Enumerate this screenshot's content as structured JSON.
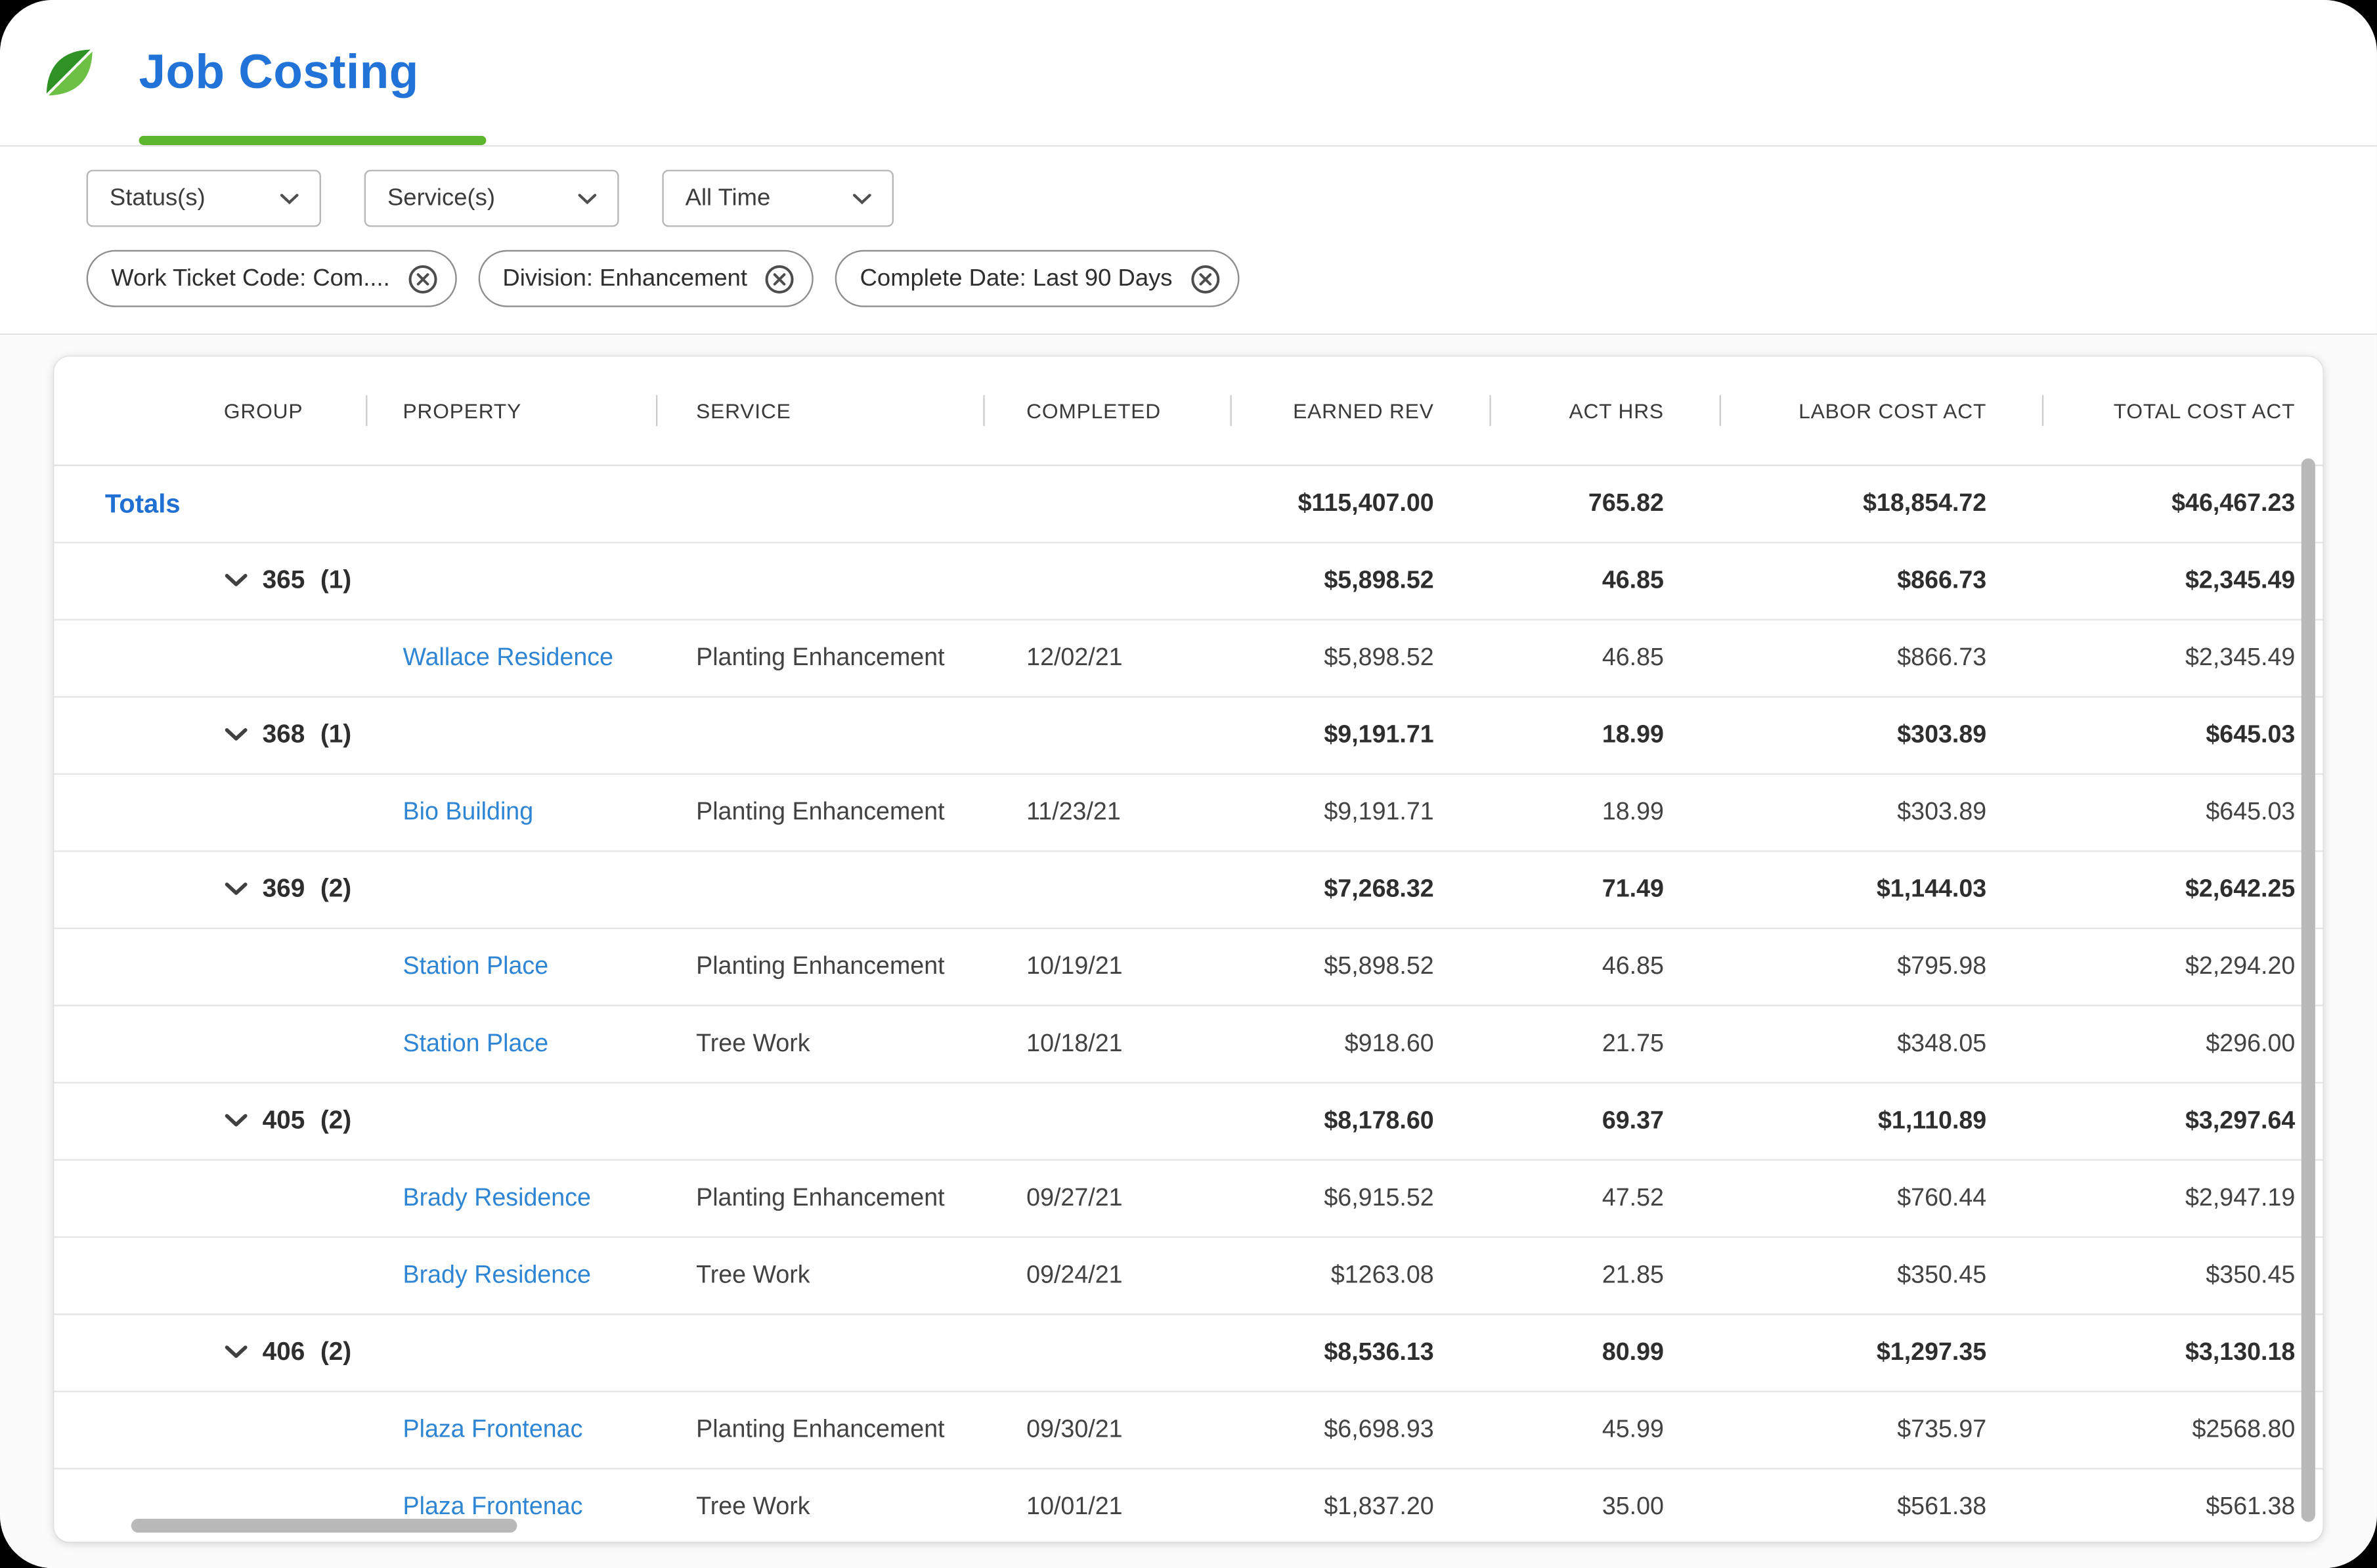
{
  "app": {
    "window_title": "Job Costing"
  },
  "theme": {
    "brand_blue": "#2273d8",
    "brand_green": "#5cb62e",
    "link_blue": "#2e85d4"
  },
  "filters": {
    "dropdowns": [
      {
        "label": "Status(s)",
        "icon": "chevron-down-icon"
      },
      {
        "label": "Service(s)",
        "icon": "chevron-down-icon"
      },
      {
        "label": "All Time",
        "icon": "chevron-down-icon"
      }
    ],
    "chips": [
      {
        "label": "Work Ticket Code: Com....",
        "icon": "circle-x-icon"
      },
      {
        "label": "Division: Enhancement",
        "icon": "circle-x-icon"
      },
      {
        "label": "Complete Date: Last 90 Days",
        "icon": "circle-x-icon"
      }
    ]
  },
  "table": {
    "columns": [
      "GROUP",
      "PROPERTY",
      "SERVICE",
      "COMPLETED",
      "EARNED REV",
      "ACT HRS",
      "LABOR COST ACT",
      "TOTAL COST ACT"
    ],
    "totals": {
      "label": "Totals",
      "earned_rev": "$115,407.00",
      "act_hrs": "765.82",
      "labor_cost_act": "$18,854.72",
      "total_cost_act": "$46,467.23"
    },
    "groups": [
      {
        "group": "365",
        "count": "(1)",
        "earned_rev": "$5,898.52",
        "act_hrs": "46.85",
        "labor_cost_act": "$866.73",
        "total_cost_act": "$2,345.49",
        "rows": [
          {
            "property": "Wallace Residence",
            "service": "Planting Enhancement",
            "completed": "12/02/21",
            "earned_rev": "$5,898.52",
            "act_hrs": "46.85",
            "labor_cost_act": "$866.73",
            "total_cost_act": "$2,345.49"
          }
        ]
      },
      {
        "group": "368",
        "count": "(1)",
        "earned_rev": "$9,191.71",
        "act_hrs": "18.99",
        "labor_cost_act": "$303.89",
        "total_cost_act": "$645.03",
        "rows": [
          {
            "property": "Bio Building",
            "service": "Planting Enhancement",
            "completed": "11/23/21",
            "earned_rev": "$9,191.71",
            "act_hrs": "18.99",
            "labor_cost_act": "$303.89",
            "total_cost_act": "$645.03"
          }
        ]
      },
      {
        "group": "369",
        "count": "(2)",
        "earned_rev": "$7,268.32",
        "act_hrs": "71.49",
        "labor_cost_act": "$1,144.03",
        "total_cost_act": "$2,642.25",
        "rows": [
          {
            "property": "Station Place",
            "service": "Planting Enhancement",
            "completed": "10/19/21",
            "earned_rev": "$5,898.52",
            "act_hrs": "46.85",
            "labor_cost_act": "$795.98",
            "total_cost_act": "$2,294.20"
          },
          {
            "property": "Station Place",
            "service": "Tree Work",
            "completed": "10/18/21",
            "earned_rev": "$918.60",
            "act_hrs": "21.75",
            "labor_cost_act": "$348.05",
            "total_cost_act": "$296.00"
          }
        ]
      },
      {
        "group": "405",
        "count": "(2)",
        "earned_rev": "$8,178.60",
        "act_hrs": "69.37",
        "labor_cost_act": "$1,110.89",
        "total_cost_act": "$3,297.64",
        "rows": [
          {
            "property": "Brady Residence",
            "service": "Planting Enhancement",
            "completed": "09/27/21",
            "earned_rev": "$6,915.52",
            "act_hrs": "47.52",
            "labor_cost_act": "$760.44",
            "total_cost_act": "$2,947.19"
          },
          {
            "property": "Brady Residence",
            "service": "Tree Work",
            "completed": "09/24/21",
            "earned_rev": "$1263.08",
            "act_hrs": "21.85",
            "labor_cost_act": "$350.45",
            "total_cost_act": "$350.45"
          }
        ]
      },
      {
        "group": "406",
        "count": "(2)",
        "earned_rev": "$8,536.13",
        "act_hrs": "80.99",
        "labor_cost_act": "$1,297.35",
        "total_cost_act": "$3,130.18",
        "rows": [
          {
            "property": "Plaza Frontenac",
            "service": "Planting Enhancement",
            "completed": "09/30/21",
            "earned_rev": "$6,698.93",
            "act_hrs": "45.99",
            "labor_cost_act": "$735.97",
            "total_cost_act": "$2568.80"
          },
          {
            "property": "Plaza Frontenac",
            "service": "Tree Work",
            "completed": "10/01/21",
            "earned_rev": "$1,837.20",
            "act_hrs": "35.00",
            "labor_cost_act": "$561.38",
            "total_cost_act": "$561.38"
          }
        ]
      }
    ]
  }
}
